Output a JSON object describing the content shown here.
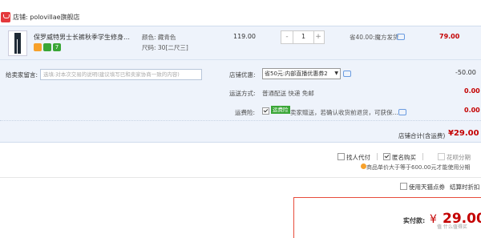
{
  "shop": {
    "label": "店铺: polovillae旗舰店"
  },
  "item": {
    "title": "保罗威特男士长裤秋季学生修身…",
    "color_label": "颜色: 藏青色",
    "size_label": "尺码: 30[二尺三]",
    "price": "119.00",
    "quantity": "1",
    "minus": "-",
    "plus": "+",
    "save_note": "省40.00:魔方发货",
    "subtotal": "79.00"
  },
  "message": {
    "label": "给卖家留言:",
    "placeholder": "选填:对本次交易的说明(建议填写已和卖家协商一致的内容)"
  },
  "promo": {
    "label": "店铺优惠:",
    "selected": "省50元:内部直播优惠券2",
    "value": "-50.00"
  },
  "shipping": {
    "label": "运送方式:",
    "value": "普通配送 快递 免邮",
    "amount": "0.00"
  },
  "freight_insurance": {
    "label": "运费险:",
    "tag": "运费险",
    "desc": "卖家赠送，若确认收货前退货，可获保…",
    "amount": "0.00"
  },
  "shop_total": {
    "label": "店铺合计(含运费)",
    "value": "¥29.00"
  },
  "options": {
    "proxy": "找人代付",
    "anonymous": "匿名购买",
    "huabei": "花呗分期",
    "tip": "商品单价大于等于600.00元才能使用分期"
  },
  "footer": {
    "coupon": "使用天猫点券",
    "settle": "结算时折扣",
    "pay_label": "实付款:",
    "pay_yen": "¥",
    "pay_value": "29.00",
    "watermark": "值 什么值得买"
  },
  "colors": {
    "price_red": "#c40000",
    "panel_bg": "#eef3fb",
    "badge_orange": "#f7a12b",
    "badge_green": "#3aa636"
  }
}
